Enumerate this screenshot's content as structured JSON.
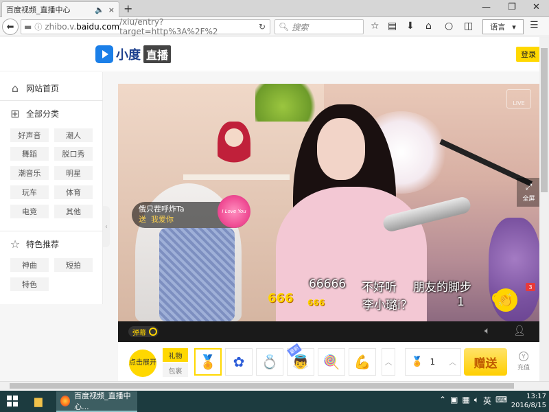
{
  "browser": {
    "tab_title": "百度视频_直播中心",
    "tab_audio_icon": "speaker-icon",
    "tab_close": "×",
    "new_tab": "+",
    "url_prefix": "zhibo.v.",
    "url_domain": "baidu.com",
    "url_rest": "/xiu/entry?target=http%3A%2F%2",
    "search_placeholder": "搜索",
    "lang_button": "语言",
    "window_min": "—",
    "window_restore": "❐",
    "window_close": "✕"
  },
  "header": {
    "logo_name": "小度",
    "logo_badge": "直播",
    "login": "登录"
  },
  "sidebar": {
    "home": "网站首页",
    "all_categories": "全部分类",
    "category_tags": [
      "好声音",
      "潮人",
      "舞蹈",
      "脱口秀",
      "潮音乐",
      "明星",
      "玩车",
      "体育",
      "电竞",
      "其他"
    ],
    "featured": "特色推荐",
    "featured_tags": [
      "神曲",
      "短拍",
      "特色"
    ]
  },
  "video": {
    "live_logo": "LIVE",
    "fullscreen": "全屏",
    "gift_user": "俄只茬呼炸Ta",
    "gift_text_prefix": "送",
    "gift_text_item": "我爱你",
    "heart_text": "I Love You",
    "danmu": [
      "66666",
      "不好听",
      "朋友的脚步",
      "李小璐i？",
      "1"
    ],
    "emoji_666": "666",
    "badge_count": "3"
  },
  "controls": {
    "danmu_toggle": "弹幕"
  },
  "gift_bar": {
    "expand": "点击展开",
    "tab_gift": "礼物",
    "tab_bag": "包裹",
    "new_tag": "最新",
    "quantity": "1",
    "send": "赠送",
    "recharge": "充值",
    "recharge_icon_text": "Y"
  },
  "taskbar": {
    "app_title": "百度视频_直播中心...",
    "ime": "英",
    "time": "13:17",
    "date": "2016/8/15"
  },
  "colors": {
    "accent_yellow": "#ffd800",
    "logo_blue": "#1b7fe8",
    "taskbar": "#1c3b3f"
  }
}
